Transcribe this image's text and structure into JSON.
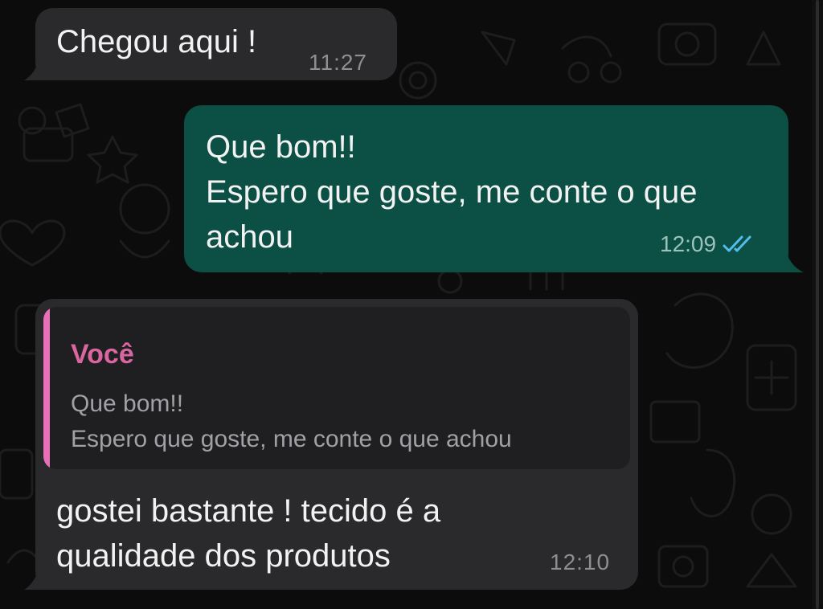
{
  "messages": [
    {
      "direction": "incoming",
      "text": "Chegou aqui !",
      "time": "11:27"
    },
    {
      "direction": "outgoing",
      "lines": [
        "Que bom!!",
        "Espero que goste, me conte o que",
        "achou"
      ],
      "time": "12:09",
      "status": "read",
      "status_icon": "double-check-icon"
    },
    {
      "direction": "incoming",
      "quote": {
        "author": "Você",
        "lines": [
          "Que bom!!",
          "Espero que goste, me conte o que achou"
        ]
      },
      "lines": [
        "gostei bastante ! tecido é a",
        "qualidade dos produtos"
      ],
      "time": "12:10"
    }
  ],
  "colors": {
    "background": "#0c0c0c",
    "incoming_bubble": "#2a2a2c",
    "outgoing_bubble": "#0b4f45",
    "quote_bar": "#e870b9",
    "quote_author": "#d9669f",
    "read_ticks": "#53bdeb"
  }
}
